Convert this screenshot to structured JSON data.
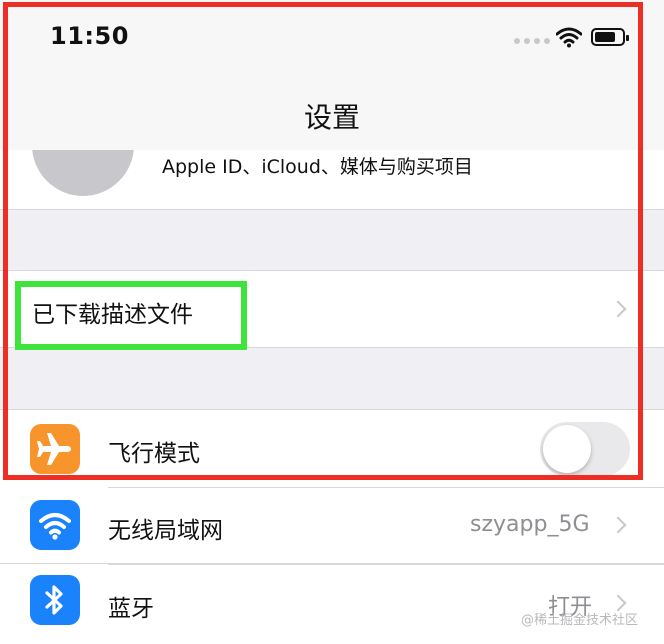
{
  "status_bar": {
    "time": "11:50"
  },
  "nav": {
    "title": "设置"
  },
  "profile": {
    "subtitle": "Apple ID、iCloud、媒体与购买项目"
  },
  "rows": {
    "profiles": {
      "label": "已下载描述文件"
    },
    "airplane": {
      "label": "飞行模式",
      "toggle_on": false
    },
    "wifi": {
      "label": "无线局域网",
      "value": "szyapp_5G"
    },
    "bluetooth": {
      "label": "蓝牙",
      "value": "打开"
    }
  },
  "colors": {
    "highlight_outer": "#ee2e24",
    "highlight_inner": "#3ee33b",
    "airplane_icon": "#f7952c",
    "wifi_icon": "#1a82fb",
    "bluetooth_icon": "#1a82fb"
  },
  "icons": [
    "airplane-icon",
    "wifi-icon",
    "bluetooth-icon",
    "chevron-right-icon"
  ],
  "watermark": "@稀土掘金技术社区"
}
